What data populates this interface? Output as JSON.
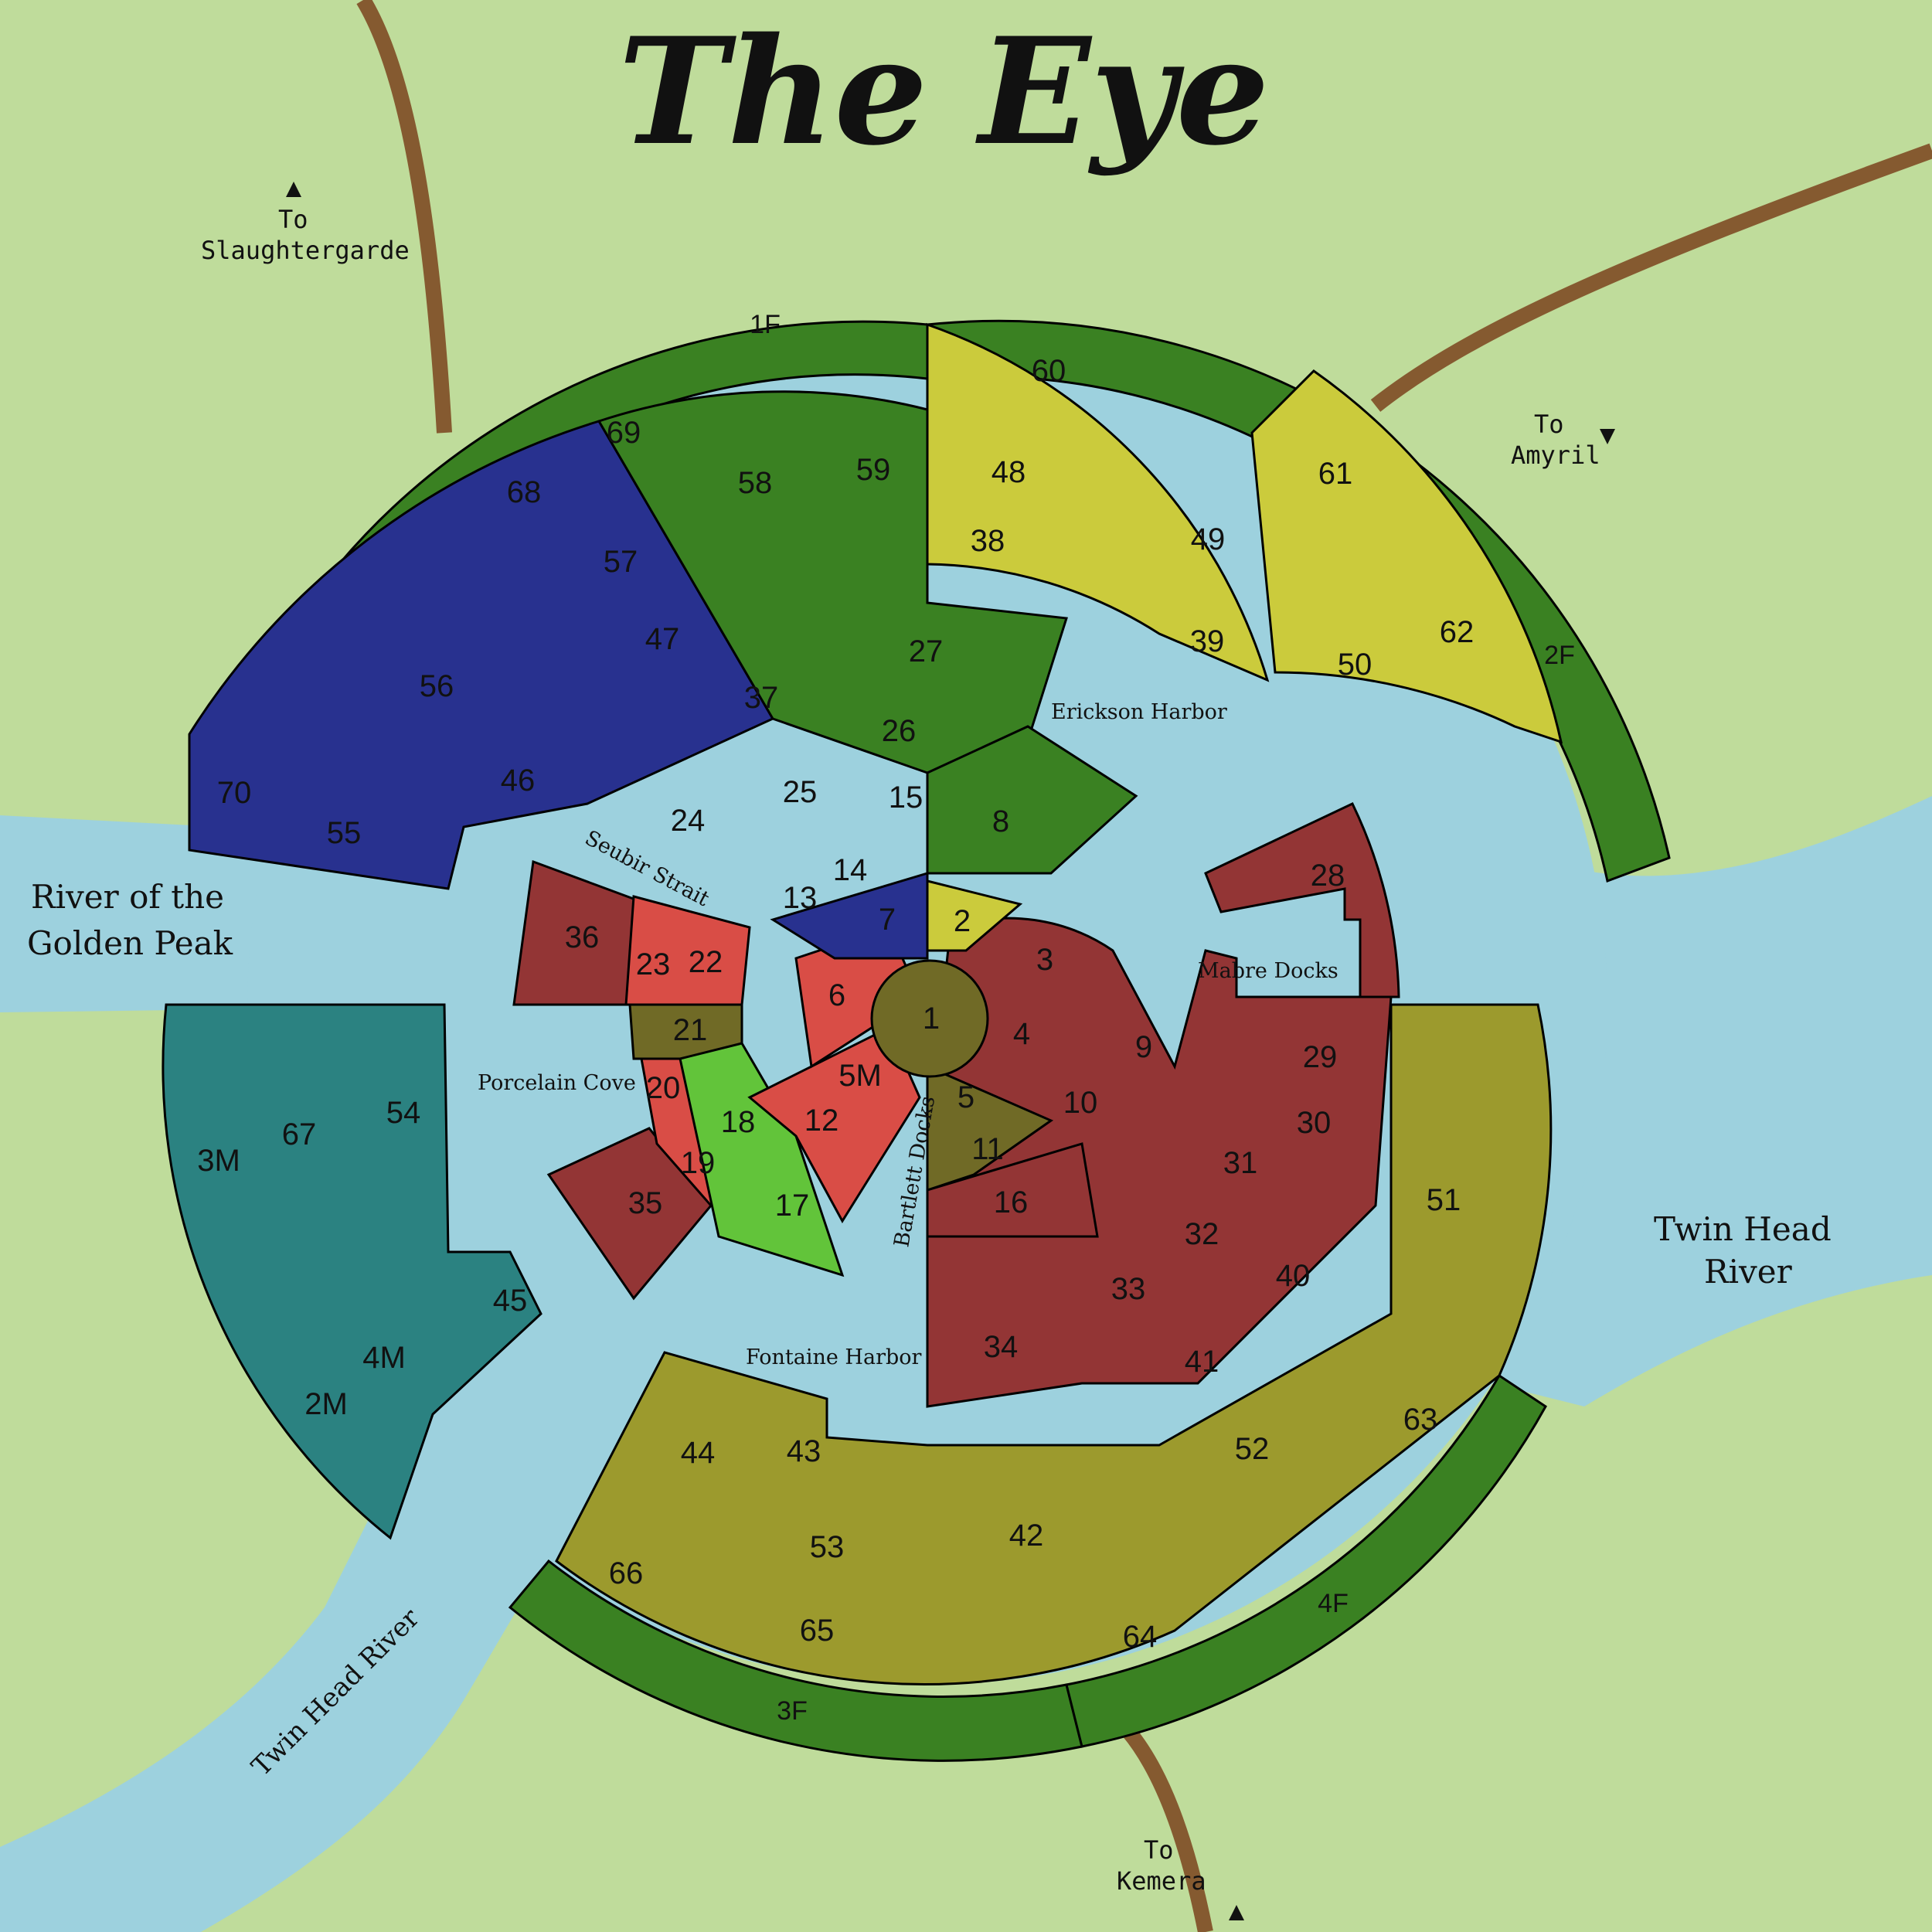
{
  "title": "The Eye",
  "colors": {
    "land": "#bfdc9b",
    "water": "#9dd1de",
    "road": "#855a30",
    "forest": "#3a8122",
    "blue": "#28318f",
    "yellow": "#cbcb3c",
    "olive": "#9c9a2d",
    "teal": "#2b8281",
    "darkred": "#933535",
    "red": "#d94d46",
    "brown": "#706a26",
    "lime": "#62c43a"
  },
  "directions": {
    "slaughtergarde": [
      "To",
      "Slaughtergarde"
    ],
    "amyril": [
      "To",
      "Amyril"
    ],
    "kemera": [
      "To",
      "Kemera"
    ]
  },
  "rivers": {
    "golden_peak": [
      "River of the",
      "Golden Peak"
    ],
    "twin_head_east": [
      "Twin Head",
      "River"
    ],
    "twin_head_south": "Twin Head River"
  },
  "places": {
    "erickson": "Erickson Harbor",
    "mabre": "Mabre Docks",
    "seubir": "Seubir Strait",
    "porcelain": "Porcelain Cove",
    "bartlett": "Bartlett Docks",
    "fontaine": "Fontaine Harbor"
  },
  "plots": [
    {
      "id": "1",
      "color": "brown"
    },
    {
      "id": "2",
      "color": "yellow"
    },
    {
      "id": "3",
      "color": "darkred"
    },
    {
      "id": "4",
      "color": "darkred"
    },
    {
      "id": "5",
      "color": "brown"
    },
    {
      "id": "5M",
      "color": "red"
    },
    {
      "id": "6",
      "color": "red"
    },
    {
      "id": "7",
      "color": "blue"
    },
    {
      "id": "8",
      "color": "forest"
    },
    {
      "id": "9",
      "color": "darkred"
    },
    {
      "id": "10",
      "color": "darkred"
    },
    {
      "id": "11",
      "color": "brown"
    },
    {
      "id": "12",
      "color": "red"
    },
    {
      "id": "13",
      "color": "blue"
    },
    {
      "id": "14",
      "color": "blue"
    },
    {
      "id": "15",
      "color": "blue"
    },
    {
      "id": "16",
      "color": "darkred"
    },
    {
      "id": "17",
      "color": "lime"
    },
    {
      "id": "18",
      "color": "lime"
    },
    {
      "id": "19",
      "color": "red"
    },
    {
      "id": "20",
      "color": "red"
    },
    {
      "id": "21",
      "color": "brown"
    },
    {
      "id": "22",
      "color": "red"
    },
    {
      "id": "23",
      "color": "red"
    },
    {
      "id": "24",
      "color": "blue"
    },
    {
      "id": "25",
      "color": "blue"
    },
    {
      "id": "26",
      "color": "blue"
    },
    {
      "id": "27",
      "color": "forest"
    },
    {
      "id": "28",
      "color": "darkred"
    },
    {
      "id": "29",
      "color": "darkred"
    },
    {
      "id": "30",
      "color": "darkred"
    },
    {
      "id": "31",
      "color": "darkred"
    },
    {
      "id": "32",
      "color": "darkred"
    },
    {
      "id": "33",
      "color": "darkred"
    },
    {
      "id": "34",
      "color": "darkred"
    },
    {
      "id": "35",
      "color": "darkred"
    },
    {
      "id": "36",
      "color": "darkred"
    },
    {
      "id": "37",
      "color": "forest"
    },
    {
      "id": "38",
      "color": "yellow"
    },
    {
      "id": "39",
      "color": "yellow"
    },
    {
      "id": "40",
      "color": "darkred"
    },
    {
      "id": "41",
      "color": "darkred"
    },
    {
      "id": "42",
      "color": "olive"
    },
    {
      "id": "43",
      "color": "olive"
    },
    {
      "id": "44",
      "color": "olive"
    },
    {
      "id": "45",
      "color": "teal"
    },
    {
      "id": "46",
      "color": "blue"
    },
    {
      "id": "47",
      "color": "blue"
    },
    {
      "id": "48",
      "color": "yellow"
    },
    {
      "id": "49",
      "color": "yellow"
    },
    {
      "id": "50",
      "color": "yellow"
    },
    {
      "id": "51",
      "color": "olive"
    },
    {
      "id": "52",
      "color": "olive"
    },
    {
      "id": "53",
      "color": "olive"
    },
    {
      "id": "54",
      "color": "teal"
    },
    {
      "id": "55",
      "color": "blue"
    },
    {
      "id": "56",
      "color": "blue"
    },
    {
      "id": "57",
      "color": "blue"
    },
    {
      "id": "58",
      "color": "forest"
    },
    {
      "id": "59",
      "color": "forest"
    },
    {
      "id": "60",
      "color": "yellow"
    },
    {
      "id": "61",
      "color": "yellow"
    },
    {
      "id": "62",
      "color": "yellow"
    },
    {
      "id": "63",
      "color": "olive"
    },
    {
      "id": "64",
      "color": "olive"
    },
    {
      "id": "65",
      "color": "olive"
    },
    {
      "id": "66",
      "color": "olive"
    },
    {
      "id": "67",
      "color": "teal"
    },
    {
      "id": "68",
      "color": "blue"
    },
    {
      "id": "69",
      "color": "forest"
    },
    {
      "id": "70",
      "color": "blue"
    },
    {
      "id": "2M",
      "color": "teal"
    },
    {
      "id": "3M",
      "color": "teal"
    },
    {
      "id": "4M",
      "color": "teal"
    },
    {
      "id": "1F",
      "color": "forest"
    },
    {
      "id": "2F",
      "color": "forest"
    },
    {
      "id": "3F",
      "color": "forest"
    },
    {
      "id": "4F",
      "color": "forest"
    }
  ]
}
